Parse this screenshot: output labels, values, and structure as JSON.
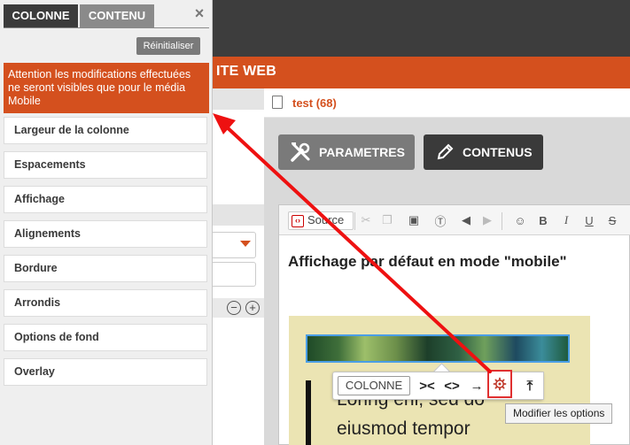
{
  "header": {
    "site_title": "ITE WEB"
  },
  "breadcrumb": {
    "label": "test (68)"
  },
  "main": {
    "parametres_label": "PARAMETRES",
    "contenus_label": "CONTENUS"
  },
  "editor": {
    "source_label": "Source",
    "heading": "Affichage par défaut en mode \"mobile\"",
    "overlay_line1": "Loring enl, sed do",
    "overlay_line2": "eiusmod tempor"
  },
  "float_toolbar": {
    "colonne_label": "COLONNE",
    "tooltip": "Modifier les options"
  },
  "panel": {
    "tab_colonne": "COLONNE",
    "tab_contenu": "CONTENU",
    "close": "×",
    "reset_label": "Réinitialiser",
    "warning": "Attention les modifications effectuées ne seront visibles que pour le média Mobile",
    "items": [
      {
        "label": "Largeur de la colonne"
      },
      {
        "label": "Espacements"
      },
      {
        "label": "Affichage"
      },
      {
        "label": "Alignements"
      },
      {
        "label": "Bordure"
      },
      {
        "label": "Arrondis"
      },
      {
        "label": "Options de fond"
      },
      {
        "label": "Overlay"
      }
    ]
  },
  "colors": {
    "accent": "#d4501e",
    "dark": "#3b3b3b",
    "highlight": "#e03030"
  }
}
